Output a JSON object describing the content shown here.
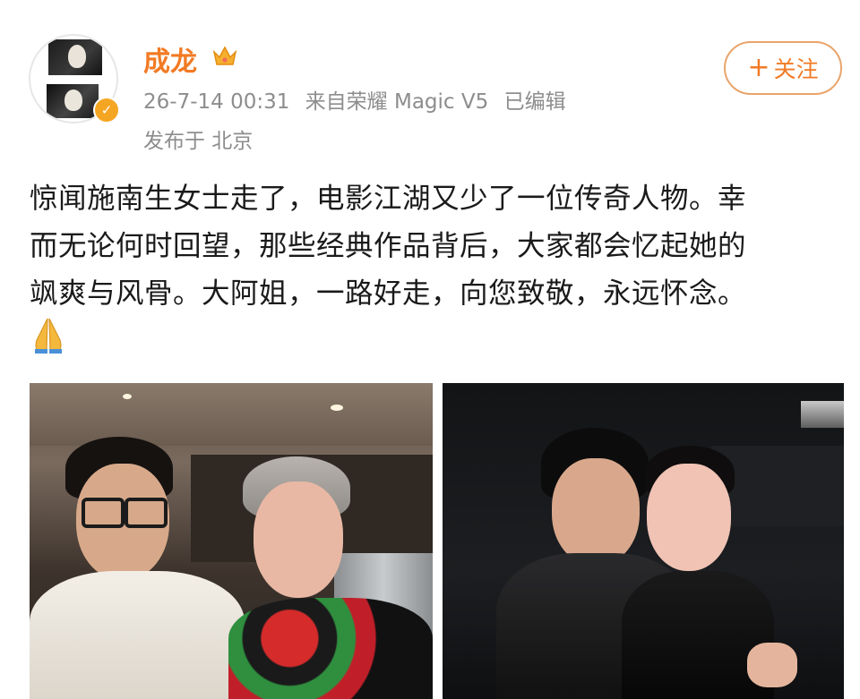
{
  "user": {
    "name": "成龙",
    "crown_icon": "crown-icon",
    "verified_icon": "verified-badge-icon",
    "verified_glyph": "✓"
  },
  "post_meta": {
    "time": "26-7-14 00:31",
    "source": "来自荣耀 Magic V5",
    "edited": "已编辑",
    "location": "发布于 北京"
  },
  "follow_button": {
    "plus": "+",
    "label": "关注"
  },
  "post": {
    "lines": [
      "惊闻施南生女士走了，电影江湖又少了一位传奇人物。幸",
      "而无论何时回望，那些经典作品背后，大家都会忆起她的",
      "飒爽与风骨。大阿姐，一路好走，向您致敬，永远怀念。"
    ],
    "emoji": "🙏"
  },
  "images": [
    {
      "name": "photo-1"
    },
    {
      "name": "photo-2"
    }
  ],
  "colors": {
    "username": "#f27a24",
    "meta": "#8d8d8d",
    "follow_border": "#e9a46a",
    "verified_badge": "#f4a623"
  }
}
